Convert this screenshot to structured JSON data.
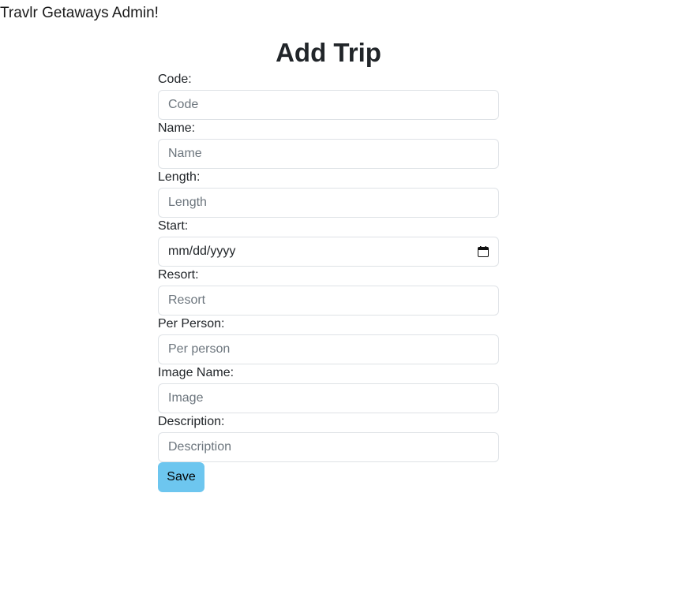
{
  "app": {
    "header_title": "Travlr Getaways Admin!"
  },
  "form": {
    "title": "Add Trip",
    "fields": {
      "code": {
        "label": "Code:",
        "placeholder": "Code"
      },
      "name": {
        "label": "Name:",
        "placeholder": "Name"
      },
      "length": {
        "label": "Length:",
        "placeholder": "Length"
      },
      "start": {
        "label": "Start:",
        "value": "mm/dd/yyyy"
      },
      "resort": {
        "label": "Resort:",
        "placeholder": "Resort"
      },
      "per_person": {
        "label": "Per Person:",
        "placeholder": "Per person"
      },
      "image": {
        "label": "Image Name:",
        "placeholder": "Image"
      },
      "description": {
        "label": "Description:",
        "placeholder": "Description"
      }
    },
    "save_label": "Save"
  },
  "colors": {
    "save_button": "#6dc6ef",
    "input_border": "#dee2e6",
    "placeholder": "#6c757d"
  },
  "icons": {
    "date_picker": "calendar-icon"
  }
}
